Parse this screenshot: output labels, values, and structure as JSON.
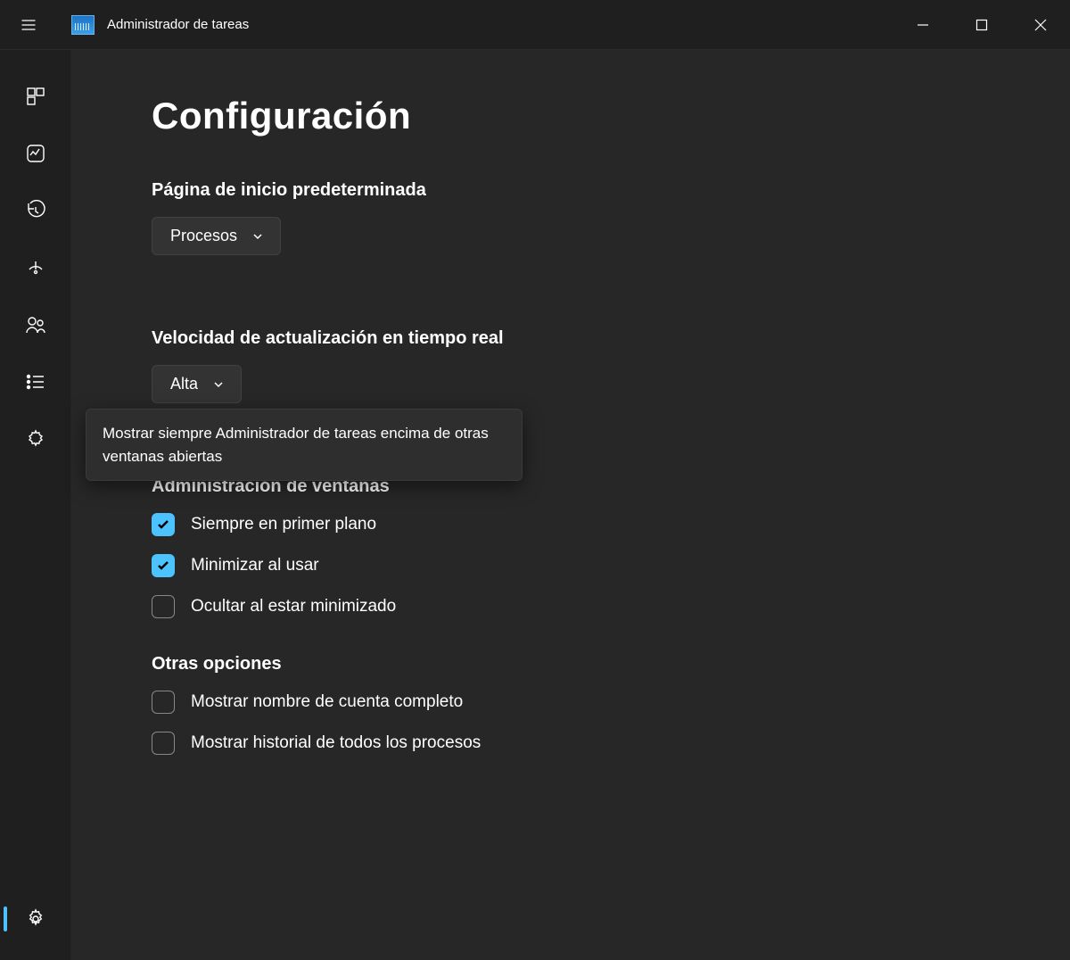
{
  "app": {
    "title": "Administrador de tareas"
  },
  "page": {
    "title": "Configuración"
  },
  "sections": {
    "default_page": {
      "label": "Página de inicio predeterminada",
      "value": "Procesos"
    },
    "update_speed": {
      "label": "Velocidad de actualización en tiempo real",
      "value": "Alta"
    },
    "window_mgmt": {
      "label": "Administración de ventanas",
      "options": [
        {
          "label": "Siempre en primer plano",
          "checked": true
        },
        {
          "label": "Minimizar al usar",
          "checked": true
        },
        {
          "label": "Ocultar al estar minimizado",
          "checked": false
        }
      ]
    },
    "other": {
      "label": "Otras opciones",
      "options": [
        {
          "label": "Mostrar nombre de cuenta completo",
          "checked": false
        },
        {
          "label": "Mostrar historial de todos los procesos",
          "checked": false
        }
      ]
    }
  },
  "tooltip": "Mostrar siempre Administrador de tareas encima de otras ventanas abiertas",
  "sidebar": {
    "items": [
      "processes-icon",
      "performance-icon",
      "app-history-icon",
      "startup-apps-icon",
      "users-icon",
      "details-icon",
      "services-icon"
    ]
  }
}
